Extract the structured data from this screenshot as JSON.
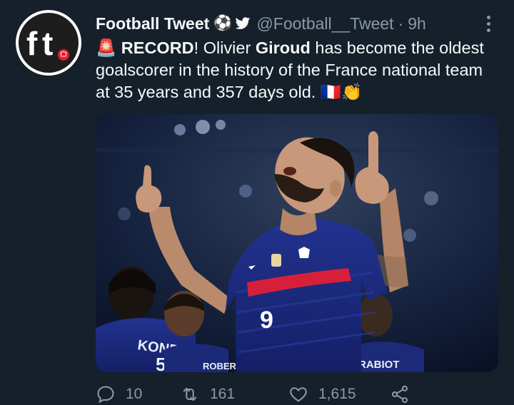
{
  "tweet": {
    "display_name": "Football Tweet",
    "badge_emoji": "⚽",
    "handle": "@Football__Tweet",
    "separator": "·",
    "time": "9h",
    "text_emoji_start": "🚨",
    "text_record": "RECORD",
    "text_part1": "! Olivier ",
    "text_giroud": "Giroud",
    "text_part2": " has become the oldest goalscorer in the history of the France national team at 35 years and 357 days old. ",
    "text_emoji_end": "🇫🇷👏"
  },
  "avatar": {
    "logo_text": "ft"
  },
  "media": {
    "jersey_number": "9",
    "teammate_left_name": "KONDE",
    "teammate_right_name": "RABIOT",
    "teammate_mid_name": "ROBERT",
    "photo_subject": "player in blue France jersey pointing both fingers up"
  },
  "actions": {
    "reply_count": "10",
    "retweet_count": "161",
    "like_count": "1,615"
  },
  "colors": {
    "background": "#15202b",
    "text_primary": "#f7f9f9",
    "text_secondary": "#8b98a5",
    "jersey_blue": "#1c2d8f",
    "jersey_red": "#d6203a"
  }
}
